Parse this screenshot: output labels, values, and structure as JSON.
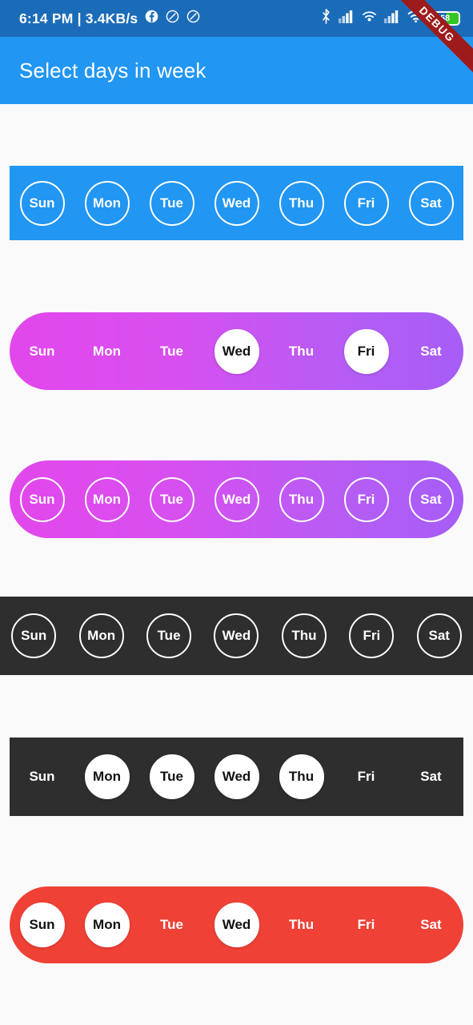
{
  "status_bar": {
    "clock": "6:14 PM | 3.4KB/s",
    "background_color": "#1B6CB8",
    "icons_left": [
      "facebook-icon",
      "block-circle-icon",
      "block-circle-icon"
    ],
    "icons_right": [
      "bluetooth-icon",
      "signal-bars-icon",
      "wifi-calling-icon",
      "signal-bars-icon",
      "wifi-icon"
    ],
    "battery_percent": "68",
    "battery_fill_color": "#34C724"
  },
  "debug_ribbon": {
    "label": "DEBUG",
    "color": "#9E1B1B"
  },
  "app_bar": {
    "title": "Select days in week",
    "background_color": "#2196F3"
  },
  "days": [
    "Sun",
    "Mon",
    "Tue",
    "Wed",
    "Thu",
    "Fri",
    "Sat"
  ],
  "widgets": [
    {
      "id": "w1",
      "style": "blue-square-outlined",
      "background_color": "#2196F3",
      "shape": "rectangle",
      "day_style": "outlined",
      "days": [
        {
          "label": "Sun",
          "selected": false
        },
        {
          "label": "Mon",
          "selected": false
        },
        {
          "label": "Tue",
          "selected": false
        },
        {
          "label": "Wed",
          "selected": false
        },
        {
          "label": "Thu",
          "selected": false
        },
        {
          "label": "Fri",
          "selected": false
        },
        {
          "label": "Sat",
          "selected": false
        }
      ]
    },
    {
      "id": "w2",
      "style": "gradient-pill-selected",
      "background_color": "linear-gradient #E247EC to #A65DF7",
      "shape": "pill",
      "day_style": "plain",
      "days": [
        {
          "label": "Sun",
          "selected": false
        },
        {
          "label": "Mon",
          "selected": false
        },
        {
          "label": "Tue",
          "selected": false
        },
        {
          "label": "Wed",
          "selected": true
        },
        {
          "label": "Thu",
          "selected": false
        },
        {
          "label": "Fri",
          "selected": true
        },
        {
          "label": "Sat",
          "selected": false
        }
      ]
    },
    {
      "id": "w3",
      "style": "gradient-pill-outlined",
      "background_color": "linear-gradient #E247EC to #A65DF7",
      "shape": "pill",
      "day_style": "outlined",
      "days": [
        {
          "label": "Sun",
          "selected": false
        },
        {
          "label": "Mon",
          "selected": false
        },
        {
          "label": "Tue",
          "selected": false
        },
        {
          "label": "Wed",
          "selected": false
        },
        {
          "label": "Thu",
          "selected": false
        },
        {
          "label": "Fri",
          "selected": false
        },
        {
          "label": "Sat",
          "selected": false
        }
      ]
    },
    {
      "id": "w4",
      "style": "dark-fullbleed-outlined",
      "background_color": "#2E2E2E",
      "shape": "rectangle-full-width",
      "day_style": "outlined",
      "days": [
        {
          "label": "Sun",
          "selected": false
        },
        {
          "label": "Mon",
          "selected": false
        },
        {
          "label": "Tue",
          "selected": false
        },
        {
          "label": "Wed",
          "selected": false
        },
        {
          "label": "Thu",
          "selected": false
        },
        {
          "label": "Fri",
          "selected": false
        },
        {
          "label": "Sat",
          "selected": false
        }
      ]
    },
    {
      "id": "w5",
      "style": "dark-square-selected",
      "background_color": "#2E2E2E",
      "shape": "rectangle",
      "day_style": "plain",
      "days": [
        {
          "label": "Sun",
          "selected": false
        },
        {
          "label": "Mon",
          "selected": true
        },
        {
          "label": "Tue",
          "selected": true
        },
        {
          "label": "Wed",
          "selected": true
        },
        {
          "label": "Thu",
          "selected": true
        },
        {
          "label": "Fri",
          "selected": false
        },
        {
          "label": "Sat",
          "selected": false
        }
      ]
    },
    {
      "id": "w6",
      "style": "red-pill-selected",
      "background_color": "#EF4136",
      "shape": "pill",
      "day_style": "plain",
      "days": [
        {
          "label": "Sun",
          "selected": true
        },
        {
          "label": "Mon",
          "selected": true
        },
        {
          "label": "Tue",
          "selected": false
        },
        {
          "label": "Wed",
          "selected": true
        },
        {
          "label": "Thu",
          "selected": false
        },
        {
          "label": "Fri",
          "selected": false
        },
        {
          "label": "Sat",
          "selected": false
        }
      ]
    }
  ]
}
